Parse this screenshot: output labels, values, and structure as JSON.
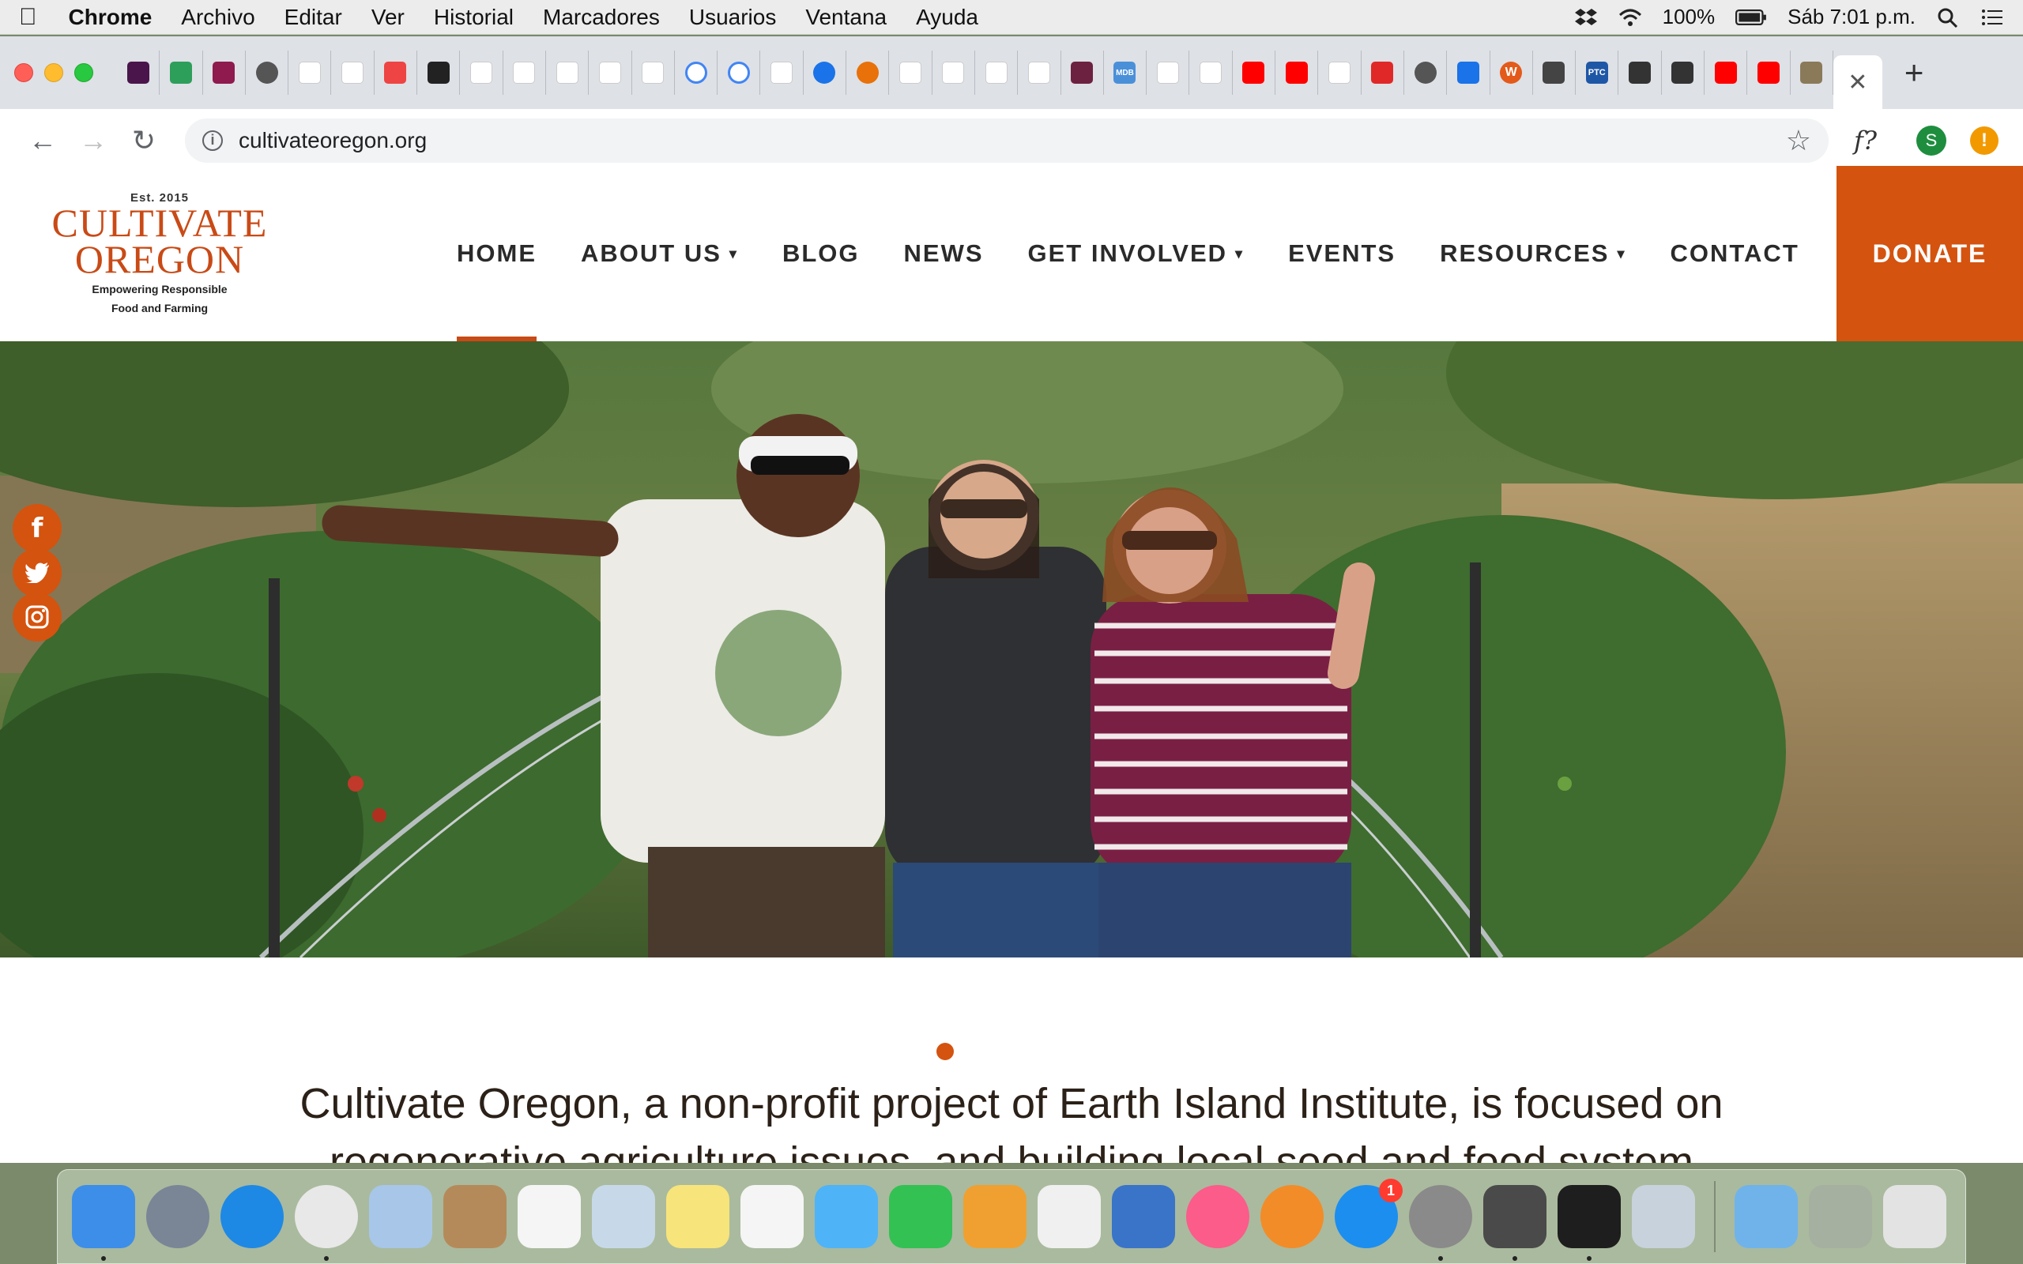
{
  "menubar": {
    "app_name": "Chrome",
    "items": [
      "Archivo",
      "Editar",
      "Ver",
      "Historial",
      "Marcadores",
      "Usuarios",
      "Ventana",
      "Ayuda"
    ],
    "battery": "100%",
    "clock": "Sáb 7:01 p.m."
  },
  "browser": {
    "tab_favicons": [
      "slack-icon",
      "people-icon",
      "shield-icon",
      "globe-icon",
      "pen-icon",
      "crest-icon",
      "colorful-icon",
      "codepen-icon",
      "triangle-icon",
      "pen-icon",
      "pen-icon",
      "pen-icon",
      "dot-icon",
      "google-icon",
      "google-icon",
      "plant-icon",
      "drop-icon",
      "circle-icon",
      "hand-icon",
      "figure-icon",
      "barcode-icon",
      "lines-icon",
      "app-icon",
      "mdb-icon",
      "music-icon",
      "music-icon",
      "youtube-icon",
      "youtube-icon",
      "music-icon",
      "flipboard-icon",
      "globe-icon",
      "bracket-icon",
      "w-icon",
      "ghost-icon",
      "ptc-icon",
      "s-icon",
      "s-icon",
      "youtube-icon",
      "youtube-icon",
      "photo-icon"
    ],
    "mdb_label": "MDB",
    "ptc_label": "PTC",
    "w_label": "W",
    "close_tab": "✕",
    "new_tab": "+",
    "url": "cultivateoregon.org",
    "ext_label": "f?",
    "avatar_letter": "S",
    "alert_symbol": "!"
  },
  "site": {
    "logo": {
      "est": "Est. 2015",
      "line1": "CULTIVATE",
      "line2": "OREGON",
      "tagline1": "Empowering Responsible",
      "tagline2": "Food and Farming"
    },
    "nav": [
      {
        "label": "HOME",
        "dropdown": false,
        "active": true
      },
      {
        "label": "ABOUT US",
        "dropdown": true,
        "active": false
      },
      {
        "label": "BLOG",
        "dropdown": false,
        "active": false
      },
      {
        "label": "NEWS",
        "dropdown": false,
        "active": false
      },
      {
        "label": "GET INVOLVED",
        "dropdown": true,
        "active": false
      },
      {
        "label": "EVENTS",
        "dropdown": false,
        "active": false
      },
      {
        "label": "RESOURCES",
        "dropdown": true,
        "active": false
      },
      {
        "label": "CONTACT",
        "dropdown": false,
        "active": false
      }
    ],
    "donate_label": "DONATE",
    "social": [
      "facebook-icon",
      "twitter-icon",
      "instagram-icon"
    ],
    "slider_dots": 3,
    "slider_active_index": 0,
    "intro_line1": "Cultivate Oregon, a non-profit project of Earth Island Institute, is focused on",
    "intro_line2": "regenerative agriculture issues, and building local seed and food system"
  },
  "dock": {
    "apps": [
      "finder-icon",
      "launchpad-icon",
      "safari-icon",
      "chrome-icon",
      "mail-icon",
      "contacts-icon",
      "reminders-icon",
      "preview-icon",
      "notes-icon",
      "photos-icon",
      "messages-icon",
      "facetime-icon",
      "pages-icon",
      "numbers-icon",
      "keynote-icon",
      "itunes-icon",
      "ibooks-icon",
      "appstore-icon",
      "system-preferences-icon",
      "sublime-icon",
      "terminal-icon",
      "image-capture-icon"
    ],
    "appstore_badge": "1",
    "trailing": [
      "downloads-folder-icon",
      "document-stack-icon",
      "trash-icon"
    ]
  }
}
